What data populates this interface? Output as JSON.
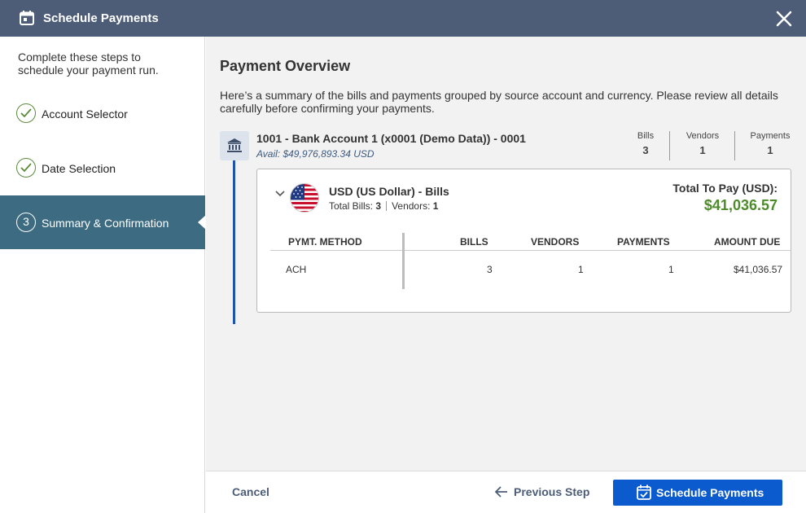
{
  "dialog": {
    "title": "Schedule Payments",
    "close_icon": "close-icon",
    "title_icon": "calendar-icon"
  },
  "sidebar": {
    "intro": "Complete these steps to schedule your payment run.",
    "steps": [
      {
        "label": "Account Selector",
        "state": "complete",
        "icon": "check-icon"
      },
      {
        "label": "Date Selection",
        "state": "complete",
        "icon": "check-icon"
      },
      {
        "label": "Summary & Confirmation",
        "state": "active",
        "number": "3"
      }
    ]
  },
  "main": {
    "heading": "Payment Overview",
    "description": "Here’s a summary of the bills and payments grouped by source account and currency. Please review all details carefully before confirming your payments.",
    "account": {
      "name": "1001 - Bank Account 1 (x0001 (Demo Data)) - 0001",
      "avail": "Avail: $49,976,893.34 USD",
      "icon": "bank-icon",
      "stats": [
        {
          "label": "Bills",
          "value": "3"
        },
        {
          "label": "Vendors",
          "value": "1"
        },
        {
          "label": "Payments",
          "value": "1"
        }
      ]
    },
    "currency": {
      "title": "USD (US Dollar) - Bills",
      "total_bills_label": "Total Bills:",
      "total_bills": "3",
      "vendors_label": "Vendors:",
      "vendors": "1",
      "total_to_pay_label": "Total To Pay (USD):",
      "total_to_pay": "$41,036.57",
      "flag_icon": "us-flag-icon"
    },
    "table": {
      "headers": [
        "PYMT. METHOD",
        "BILLS",
        "VENDORS",
        "PAYMENTS",
        "AMOUNT DUE"
      ],
      "rows": [
        [
          "ACH",
          "3",
          "1",
          "1",
          "$41,036.57"
        ]
      ]
    }
  },
  "footer": {
    "cancel": "Cancel",
    "previous": "Previous Step",
    "schedule": "Schedule Payments"
  },
  "colors": {
    "header_bg": "#4d5d78",
    "active_step_bg": "#3d6b82",
    "primary_button": "#0b5bcf",
    "total_amount": "#4e8b2b",
    "timeline": "#1c55b0"
  }
}
